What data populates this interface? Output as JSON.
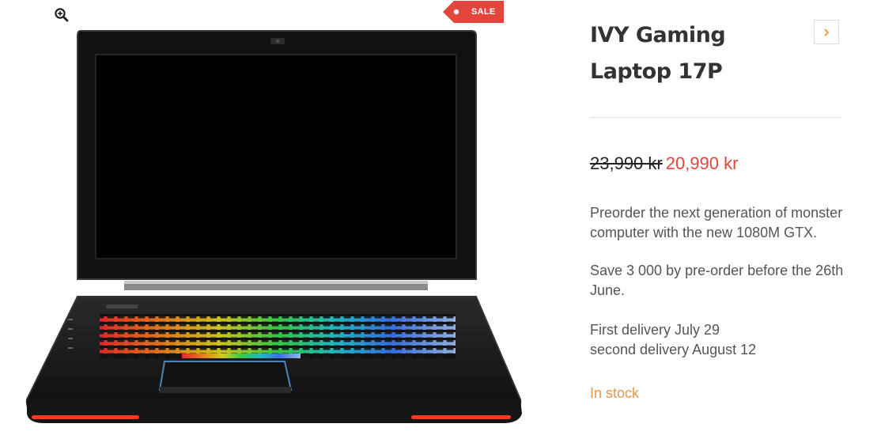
{
  "gallery": {
    "zoom_icon": "magnifier-plus-icon",
    "sale_badge": "SALE",
    "image_alt": "IVY Gaming Laptop 17P"
  },
  "product": {
    "title": "IVY Gaming Laptop 17P",
    "price_old": "23,990 kr",
    "price_new": "20,990 kr",
    "description_1": "Preorder the next generation of monster computer with the new 1080M GTX.",
    "description_2": "Save 3 000 by pre-order before the 26th June.",
    "description_3_line1": "First delivery July 29",
    "description_3_line2": "second delivery August 12",
    "stock_status": "In stock"
  },
  "nav": {
    "next_icon": "chevron-right-icon"
  },
  "colors": {
    "sale": "#e2453c",
    "price_new": "#e2453c",
    "stock": "#e9964d",
    "accent_arrow": "#f0a040"
  }
}
